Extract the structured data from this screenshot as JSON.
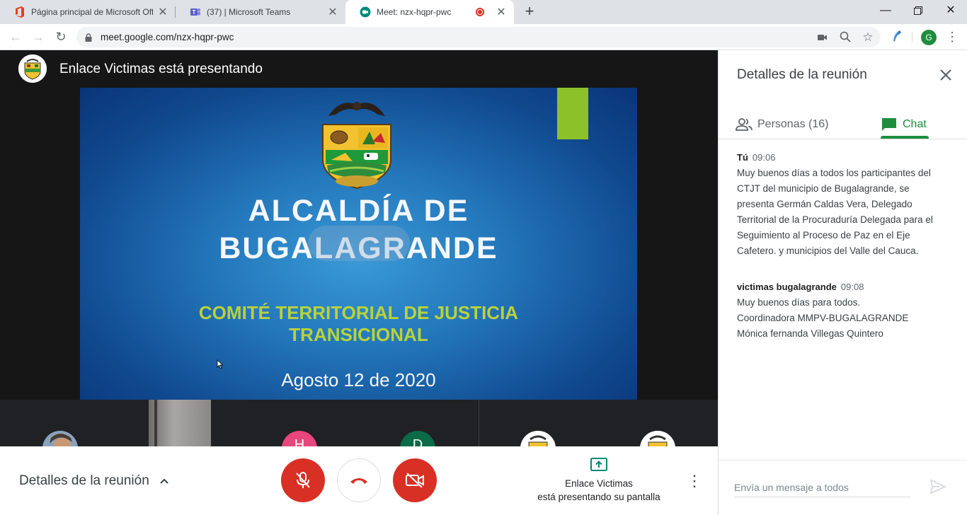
{
  "browser": {
    "tabs": [
      {
        "title": "Página principal de Microsoft Office",
        "icon": "office-icon"
      },
      {
        "title": "(37) | Microsoft Teams",
        "icon": "teams-icon"
      },
      {
        "title": "Meet: nzx-hqpr-pwc",
        "icon": "meet-icon"
      }
    ],
    "url": "meet.google.com/nzx-hqpr-pwc",
    "profile_initial": "G"
  },
  "meet": {
    "presenter_banner": "Enlace Victimas está presentando",
    "slide": {
      "title_line1": "ALCALDÍA DE",
      "title_line2": "BUGALAGRANDE",
      "subtitle_line1": "COMITÉ TERRITORIAL DE JUSTICIA",
      "subtitle_line2": "TRANSICIONAL",
      "date": "Agosto 12 de 2020",
      "colors": {
        "accent": "#b9d23b",
        "green_tab": "#8dc12a"
      }
    },
    "filmstrip": [
      {
        "initial": "H",
        "color": "#e8467c"
      },
      {
        "initial": "D",
        "color": "#0b6b48"
      }
    ],
    "bottom": {
      "details_label": "Detalles de la reunión",
      "presenting_line1": "Enlace Victimas",
      "presenting_line2": "está presentando su pantalla"
    }
  },
  "panel": {
    "title": "Detalles de la reunión",
    "tabs": {
      "people": "Personas (16)",
      "chat": "Chat"
    },
    "messages": [
      {
        "sender": "Tú",
        "time": "09:06",
        "lines": [
          "Muy buenos días a todos los participantes del",
          "CTJT del municipio de Bugalagrande, se",
          "presenta Germán Caldas Vera, Delegado",
          "Territorial de la Procuraduría Delegada para el",
          "Seguimiento al Proceso de Paz en el Eje",
          "Cafetero. y municipios del Valle  del Cauca."
        ]
      },
      {
        "sender": "victimas bugalagrande",
        "time": "09:08",
        "lines": [
          "Muy buenos días para todos.",
          "Coordinadora MMPV-BUGALAGRANDE",
          "Mónica fernanda Villegas Quintero"
        ]
      }
    ],
    "compose_placeholder": "Envía un mensaje a todos"
  }
}
